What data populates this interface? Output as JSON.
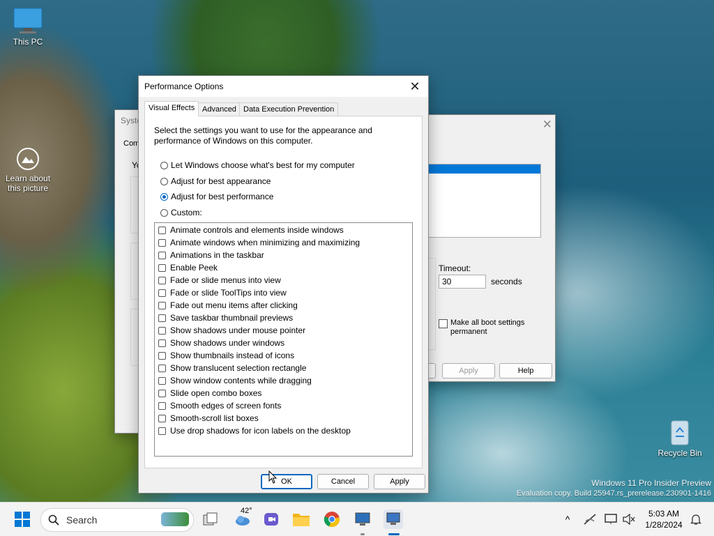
{
  "desktop": {
    "icons": [
      {
        "label": "This PC"
      },
      {
        "label": "Learn about this picture"
      },
      {
        "label": "Recycle Bin"
      }
    ],
    "watermark": {
      "line1": "Windows 11 Pro Insider Preview",
      "line2": "Evaluation copy. Build 25947.rs_prerelease.230901-1416"
    }
  },
  "back_dialog": {
    "title_partial": "Syste",
    "tab_partial": "Com",
    "text_partial": "Yo",
    "timeout_label": "Timeout:",
    "timeout_value": "30",
    "seconds_label": "seconds",
    "boot_checkbox_label": "Make all boot settings permanent",
    "apply_label": "Apply",
    "help_label": "Help"
  },
  "perf_dialog": {
    "title": "Performance Options",
    "tabs": [
      "Visual Effects",
      "Advanced",
      "Data Execution Prevention"
    ],
    "active_tab": "Visual Effects",
    "description": "Select the settings you want to use for the appearance and performance of Windows on this computer.",
    "radio_options": [
      {
        "label": "Let Windows choose what's best for my computer",
        "selected": false
      },
      {
        "label": "Adjust for best appearance",
        "selected": false
      },
      {
        "label": "Adjust for best performance",
        "selected": true
      },
      {
        "label": "Custom:",
        "selected": false
      }
    ],
    "checkboxes": [
      {
        "label": "Animate controls and elements inside windows",
        "checked": false
      },
      {
        "label": "Animate windows when minimizing and maximizing",
        "checked": false
      },
      {
        "label": "Animations in the taskbar",
        "checked": false
      },
      {
        "label": "Enable Peek",
        "checked": false
      },
      {
        "label": "Fade or slide menus into view",
        "checked": false
      },
      {
        "label": "Fade or slide ToolTips into view",
        "checked": false
      },
      {
        "label": "Fade out menu items after clicking",
        "checked": false
      },
      {
        "label": "Save taskbar thumbnail previews",
        "checked": false
      },
      {
        "label": "Show shadows under mouse pointer",
        "checked": false
      },
      {
        "label": "Show shadows under windows",
        "checked": false
      },
      {
        "label": "Show thumbnails instead of icons",
        "checked": false
      },
      {
        "label": "Show translucent selection rectangle",
        "checked": false
      },
      {
        "label": "Show window contents while dragging",
        "checked": false
      },
      {
        "label": "Slide open combo boxes",
        "checked": false
      },
      {
        "label": "Smooth edges of screen fonts",
        "checked": false
      },
      {
        "label": "Smooth-scroll list boxes",
        "checked": false
      },
      {
        "label": "Use drop shadows for icon labels on the desktop",
        "checked": false
      }
    ],
    "buttons": {
      "ok": "OK",
      "cancel": "Cancel",
      "apply": "Apply"
    }
  },
  "taskbar": {
    "search_label": "Search",
    "weather_temp": "42°",
    "time": "5:03 AM",
    "date": "1/28/2024",
    "accent": "#0067c0"
  }
}
